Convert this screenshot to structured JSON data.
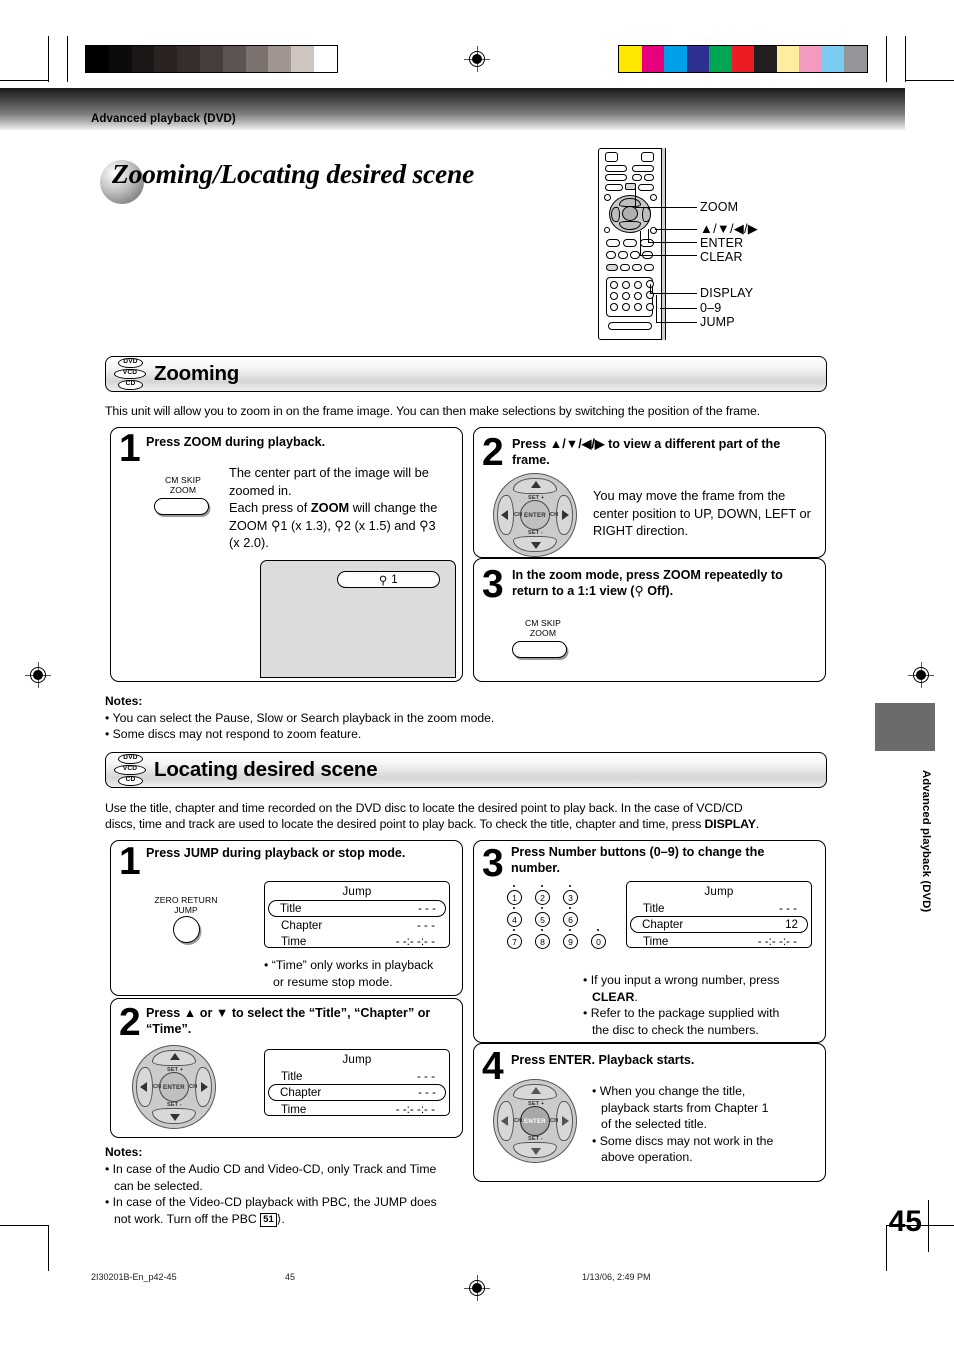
{
  "page": {
    "running_head": "Advanced playback (DVD)",
    "title": "Zooming/Locating desired scene",
    "page_number": "45",
    "side_tab_label": "Advanced playback (DVD)"
  },
  "footer": {
    "file": "2I30201B-En_p42-45",
    "page": "45",
    "timestamp": "1/13/06, 2:49 PM"
  },
  "color_bars": {
    "gray_scale": [
      "#000000",
      "#0d0a0a",
      "#1c1717",
      "#2a2322",
      "#362e2c",
      "#473d3a",
      "#5d5350",
      "#7b716e",
      "#a0968f",
      "#cfc5bf",
      "#ffffff"
    ],
    "color_patches": [
      "#ffe800",
      "#e6007e",
      "#00a0e9",
      "#2e3192",
      "#00a651",
      "#ed1c24",
      "#231f20",
      "#fcee9e",
      "#f49ac1",
      "#7accf2",
      "#939598"
    ]
  },
  "remote": {
    "callouts": [
      {
        "id": "zoom",
        "label": "ZOOM"
      },
      {
        "id": "arrows",
        "label": "▲/▼/◀/▶"
      },
      {
        "id": "enter",
        "label": "ENTER"
      },
      {
        "id": "clear",
        "label": "CLEAR"
      },
      {
        "id": "display",
        "label": "DISPLAY"
      },
      {
        "id": "numbers",
        "label": "0–9"
      },
      {
        "id": "jump",
        "label": "JUMP"
      }
    ]
  },
  "zooming_section": {
    "badges": [
      "DVD",
      "VCD",
      "CD"
    ],
    "heading": "Zooming",
    "intro": "This unit will allow you to zoom in on the frame image. You can then make selections by switching the position of the frame.",
    "steps": [
      {
        "number": "1",
        "heading": "Press ZOOM during playback.",
        "button_label_line1": "CM SKIP",
        "button_label_line2": "ZOOM",
        "body_line1": "The center part of the image will be",
        "body_line2": "zoomed in.",
        "body_line3": "Each press of ZOOM will change the",
        "body_line4": "ZOOM ☃1 (x 1.3), ☃2 (x 1.5) and ☃3",
        "body_line5": "(x 2.0).",
        "screen_badge": "☃ 1"
      },
      {
        "number": "2",
        "heading_line1": "Press ▲/▼/◀/▶ to view a different part of the",
        "heading_line2": "frame.",
        "body_line1": "You may move the frame from the",
        "body_line2": "center position to UP, DOWN, LEFT or",
        "body_line3": "RIGHT direction."
      },
      {
        "number": "3",
        "heading_line1": "In the zoom mode, press ZOOM repeatedly to",
        "heading_line2": "return to a 1:1 view (☃ Off).",
        "button_label_line1": "CM SKIP",
        "button_label_line2": "ZOOM"
      }
    ],
    "notes_title": "Notes:",
    "notes": [
      "You can select the Pause, Slow or Search playback in the zoom mode.",
      "Some discs may not respond to zoom feature."
    ]
  },
  "locating_section": {
    "badges": [
      "DVD",
      "VCD",
      "CD"
    ],
    "heading": "Locating desired scene",
    "intro_line1": "Use the title, chapter and time recorded on the DVD disc to locate the desired point to play back. In the case of VCD/CD",
    "intro_line2": "discs, time and track are used to locate the desired point to play back. To check the title, chapter and time, press DISPLAY.",
    "steps": [
      {
        "number": "1",
        "heading": "Press JUMP during playback or stop mode.",
        "button_label_line1": "ZERO RETURN",
        "button_label_line2": "JUMP",
        "osd": {
          "title": "Jump",
          "rows": [
            {
              "label": "Title",
              "value": "- - -",
              "highlighted": true
            },
            {
              "label": "Chapter",
              "value": "- - -",
              "highlighted": false
            },
            {
              "label": "Time",
              "value": "- -:- -:- -",
              "highlighted": false
            }
          ]
        },
        "note_line1": "• “Time” only works in playback",
        "note_line2": "or resume stop mode."
      },
      {
        "number": "2",
        "heading_line1": "Press ▲ or ▼ to select the “Title”, “Chapter” or",
        "heading_line2": "“Time”.",
        "osd": {
          "title": "Jump",
          "rows": [
            {
              "label": "Title",
              "value": "- - -",
              "highlighted": false
            },
            {
              "label": "Chapter",
              "value": "- - -",
              "highlighted": true
            },
            {
              "label": "Time",
              "value": "- -:- -:- -",
              "highlighted": false
            }
          ]
        }
      },
      {
        "number": "3",
        "heading_line1": "Press Number buttons (0–9) to change the",
        "heading_line2": "number.",
        "number_keys": [
          "1",
          "2",
          "3",
          "4",
          "5",
          "6",
          "7",
          "8",
          "9",
          "0"
        ],
        "osd": {
          "title": "Jump",
          "rows": [
            {
              "label": "Title",
              "value": "- - -",
              "highlighted": false
            },
            {
              "label": "Chapter",
              "value": "12",
              "highlighted": true
            },
            {
              "label": "Time",
              "value": "- -:- -:- -",
              "highlighted": false
            }
          ]
        },
        "note1_line1": "• If you input a wrong number, press",
        "note1_line2": "CLEAR.",
        "note2_line1": "• Refer to the package supplied with",
        "note2_line2": "the disc to check the numbers."
      },
      {
        "number": "4",
        "heading": "Press ENTER. Playback starts.",
        "note1_line1": "• When you change the title,",
        "note1_line2": "playback starts from Chapter 1",
        "note1_line3": "of the selected title.",
        "note2_line1": "• Some discs may not work in the",
        "note2_line2": "above operation."
      }
    ],
    "notes_title": "Notes:",
    "notes": [
      {
        "line1": "• In case of the Audio CD and Video-CD, only Track and Time",
        "line2": "can be selected."
      },
      {
        "line1": "• In case of the Video-CD playback with PBC, the JUMP does",
        "line2_pre": "not work. Turn off the PBC ",
        "page_ref": "51",
        "line2_post": "."
      }
    ]
  },
  "dpad_labels": {
    "set_plus": "SET +",
    "set_minus": "SET -",
    "enter": "ENTER",
    "ch": "CH"
  }
}
